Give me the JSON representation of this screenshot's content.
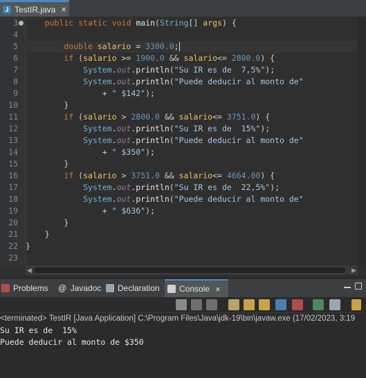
{
  "editor_tab": {
    "icon": "java-file-icon",
    "label": "TestIR.java",
    "close": "×"
  },
  "line_numbers": [
    "3",
    "4",
    "5",
    "6",
    "7",
    "8",
    "9",
    "10",
    "11",
    "12",
    "13",
    "14",
    "15",
    "16",
    "17",
    "18",
    "19",
    "20",
    "21",
    "22",
    "23"
  ],
  "code": {
    "l3": {
      "indent": "    ",
      "kw1": "public",
      "kw2": "static",
      "kw3": "void",
      "name": "main",
      "paren": "(",
      "type": "String",
      "arr": "[] ",
      "arg": "args",
      "rest": ") {"
    },
    "l5": {
      "indent": "        ",
      "kw": "double",
      "var": "salario",
      "eq": " = ",
      "num": "3300.0",
      "semi": ";"
    },
    "l6": {
      "indent": "        ",
      "kw": "if",
      "p1": " (",
      "v1": "salario",
      "op1": " >= ",
      "n1": "1900.0",
      "and": " && ",
      "v2": "salario",
      "op2": "<= ",
      "n2": "2800.0",
      "rest": ") {"
    },
    "l7": {
      "indent": "            ",
      "cls": "System",
      "dot1": ".",
      "field": "out",
      "dot2": ".",
      "method": "println",
      "p": "(",
      "str": "\"Su IR es de  7,5%\"",
      "end": ");"
    },
    "l8": {
      "indent": "            ",
      "cls": "System",
      "dot1": ".",
      "field": "out",
      "dot2": ".",
      "method": "println",
      "p": "(",
      "str": "\"Puede deducir al monto de\""
    },
    "l9": {
      "indent": "                ",
      "plus": "+ ",
      "str": "\" $142\"",
      "end": ");"
    },
    "l10": {
      "indent": "        ",
      "text": "}"
    },
    "l11": {
      "indent": "        ",
      "kw": "if",
      "p1": " (",
      "v1": "salario",
      "op1": " > ",
      "n1": "2800.0",
      "and": " && ",
      "v2": "salario",
      "op2": "<= ",
      "n2": "3751.0",
      "rest": ") {"
    },
    "l12": {
      "indent": "            ",
      "cls": "System",
      "dot1": ".",
      "field": "out",
      "dot2": ".",
      "method": "println",
      "p": "(",
      "str": "\"Su IR es de  15%\"",
      "end": ");"
    },
    "l13": {
      "indent": "            ",
      "cls": "System",
      "dot1": ".",
      "field": "out",
      "dot2": ".",
      "method": "println",
      "p": "(",
      "str": "\"Puede deducir al monto de\""
    },
    "l14": {
      "indent": "                ",
      "plus": "+ ",
      "str": "\" $350\"",
      "end": ");"
    },
    "l15": {
      "indent": "        ",
      "text": "}"
    },
    "l16": {
      "indent": "        ",
      "kw": "if",
      "p1": " (",
      "v1": "salario",
      "op1": " > ",
      "n1": "3751.0",
      "and": " && ",
      "v2": "salario",
      "op2": "<= ",
      "n2": "4664.00",
      "rest": ") {"
    },
    "l17": {
      "indent": "            ",
      "cls": "System",
      "dot1": ".",
      "field": "out",
      "dot2": ".",
      "method": "println",
      "p": "(",
      "str": "\"Su IR es de  22,5%\"",
      "end": ");"
    },
    "l18": {
      "indent": "            ",
      "cls": "System",
      "dot1": ".",
      "field": "out",
      "dot2": ".",
      "method": "println",
      "p": "(",
      "str": "\"Puede deducir al monto de\""
    },
    "l19": {
      "indent": "                ",
      "plus": "+ ",
      "str": "\" $636\"",
      "end": ");"
    },
    "l20": {
      "indent": "        ",
      "text": "}"
    },
    "l21": {
      "indent": "    ",
      "text": "}"
    },
    "l22": {
      "indent": "",
      "text": "}"
    }
  },
  "panel_tabs": {
    "problems": "Problems",
    "javadoc": "Javadoc",
    "declaration": "Declaration",
    "console": "Console",
    "console_close": "×",
    "javadoc_icon": "@"
  },
  "console_status": "<terminated> TestIR [Java Application] C:\\Program Files\\Java\\jdk-19\\bin\\javaw.exe  (17/02/2023, 3:19",
  "console_output": [
    "Su IR es de  15%",
    "Puede deducir al monto de $350"
  ],
  "colors": {
    "accent": "#4a88c7",
    "keyword": "#cc7832",
    "string": "#6a8759",
    "number": "#6897bb"
  }
}
